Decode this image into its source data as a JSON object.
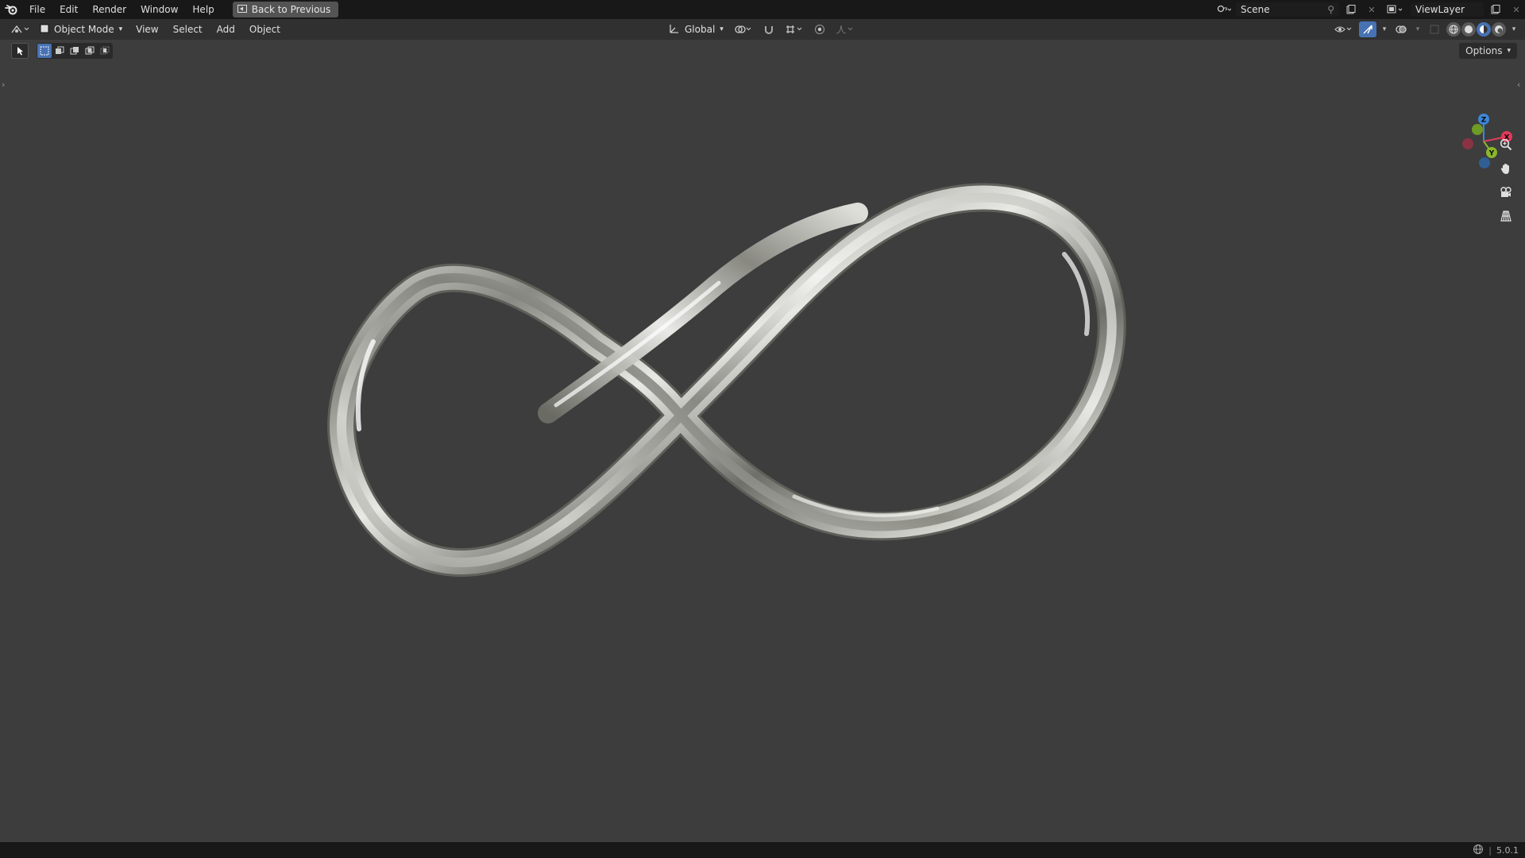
{
  "topbar": {
    "menu": [
      "File",
      "Edit",
      "Render",
      "Window",
      "Help"
    ],
    "back_label": "Back to Previous",
    "scene_name": "Scene",
    "view_layer": "ViewLayer"
  },
  "header": {
    "mode": "Object Mode",
    "menus": [
      "View",
      "Select",
      "Add",
      "Object"
    ],
    "orientation": "Global"
  },
  "viewport": {
    "options_label": "Options",
    "object": "infinity-ring",
    "gizmo_labels": {
      "z": "Z",
      "x": "X",
      "y": "Y"
    }
  },
  "status": {
    "version": "5.0.1"
  },
  "colors": {
    "accent": "#4772b3",
    "axis_x": "#e33a5c",
    "axis_y": "#8ab72b",
    "axis_z": "#3d87d9",
    "viewport_bg": "#3d3d3d"
  }
}
